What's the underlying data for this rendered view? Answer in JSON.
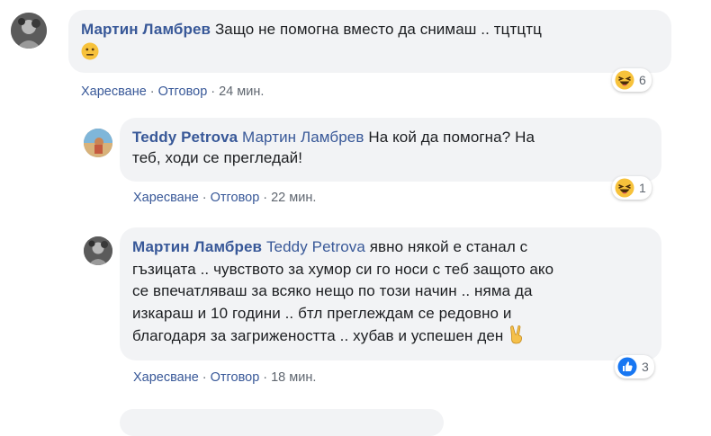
{
  "comments": [
    {
      "author": "Мартин Ламбрев",
      "text": "Защо не помогна вместо да снимаш .. тцтцтц",
      "emoji": "neutral-face-icon",
      "actions": {
        "like": "Харесване",
        "reply": "Отговор",
        "time": "24 мин."
      },
      "reaction": {
        "type": "haha-icon",
        "count": "6"
      }
    },
    {
      "author": "Teddy Petrova",
      "mention": "Мартин Ламбрев",
      "line1": "На кой да помогна? На",
      "line2": "теб, ходи се прегледай!",
      "actions": {
        "like": "Харесване",
        "reply": "Отговор",
        "time": "22 мин."
      },
      "reaction": {
        "type": "haha-icon",
        "count": "1"
      }
    },
    {
      "author": "Мартин Ламбрев",
      "mention": "Teddy Petrova",
      "line1": "явно някой е станал с",
      "line2": "гъзицата .. чувството за хумор си го носи с теб защото ако",
      "line3": "се впечатляваш за всяко нещо по този начин .. няма да",
      "line4": "изкараш и 10 години .. бтл преглеждам се редовно и",
      "line5": "благодаря за загрижеността .. хубав и успешен ден",
      "emoji": "victory-hand-icon",
      "actions": {
        "like": "Харесване",
        "reply": "Отговор",
        "time": "18 мин."
      },
      "reaction": {
        "type": "like-icon",
        "count": "3"
      }
    }
  ],
  "separator": "·",
  "colors": {
    "link": "#385898",
    "bubble": "#f2f3f5",
    "meta": "#606770"
  }
}
